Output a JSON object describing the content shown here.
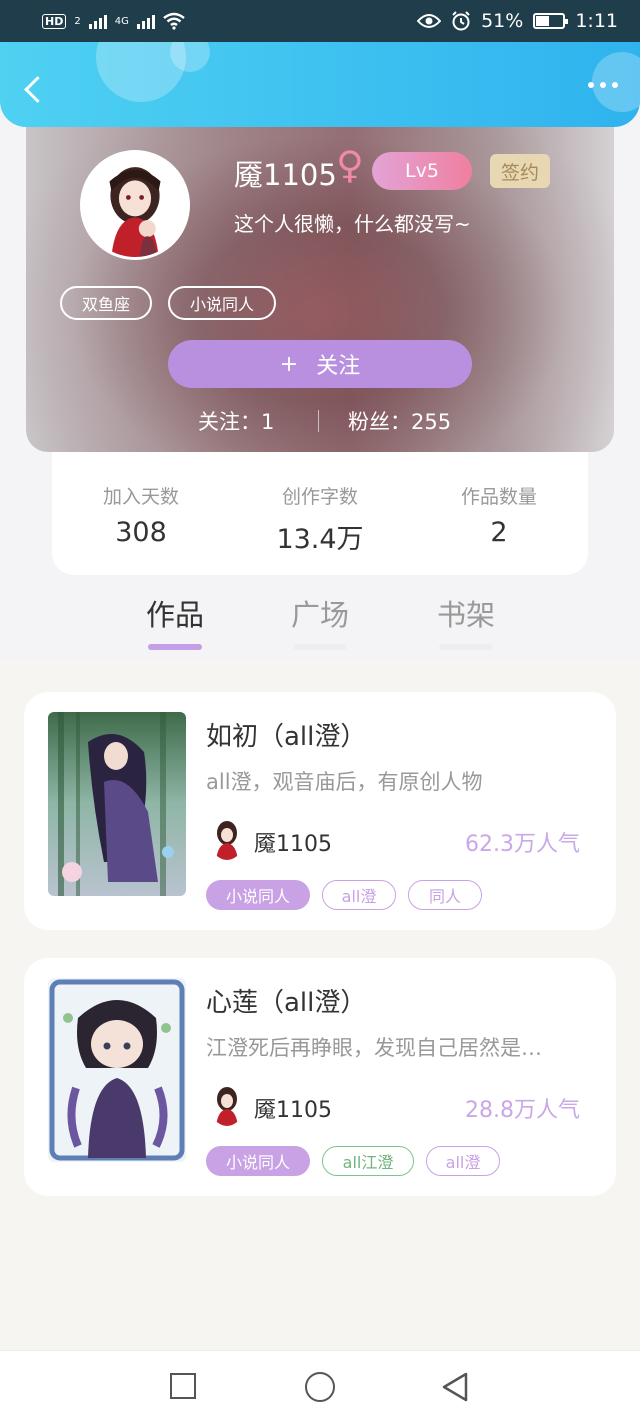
{
  "status_bar": {
    "network": "HD",
    "network_sub": "2",
    "signal_type": "4G",
    "battery": "51%",
    "time": "1:11",
    "icons": [
      "signal-icon",
      "wifi-icon",
      "eye-icon",
      "alarm-icon",
      "battery-icon"
    ]
  },
  "header": {
    "back_icon": "chevron-left-icon",
    "more_icon": "more-dots-icon"
  },
  "profile": {
    "username": "魇1105",
    "gender_symbol": "♀",
    "level": "Lv5",
    "sign_badge": "签约",
    "bio": "这个人很懒，什么都没写~",
    "tags": [
      "双鱼座",
      "小说同人"
    ],
    "follow_icon": "+",
    "follow_label": "关注",
    "following_label": "关注：1",
    "fans_label": "粉丝：255"
  },
  "stats": [
    {
      "label": "加入天数",
      "value": "308"
    },
    {
      "label": "创作字数",
      "value": "13.4万"
    },
    {
      "label": "作品数量",
      "value": "2"
    }
  ],
  "tabs": [
    {
      "label": "作品",
      "active": true
    },
    {
      "label": "广场",
      "active": false
    },
    {
      "label": "书架",
      "active": false
    }
  ],
  "works": [
    {
      "title": "如初（all澄）",
      "desc": "all澄，观音庙后，有原创人物",
      "author": "魇1105",
      "popularity": "62.3万人气",
      "tags": [
        "小说同人",
        "all澄",
        "同人"
      ]
    },
    {
      "title": "心莲（all澄）",
      "desc": "江澄死后再睁眼，发现自己居然是…",
      "author": "魇1105",
      "popularity": "28.8万人气",
      "tags": [
        "小说同人",
        "all江澄",
        "all澄"
      ]
    }
  ],
  "colors": {
    "header": "#2fb3ee",
    "accent_purple": "#b990df",
    "level_pink": "#f07fa0",
    "popularity": "#c8a8e8"
  }
}
